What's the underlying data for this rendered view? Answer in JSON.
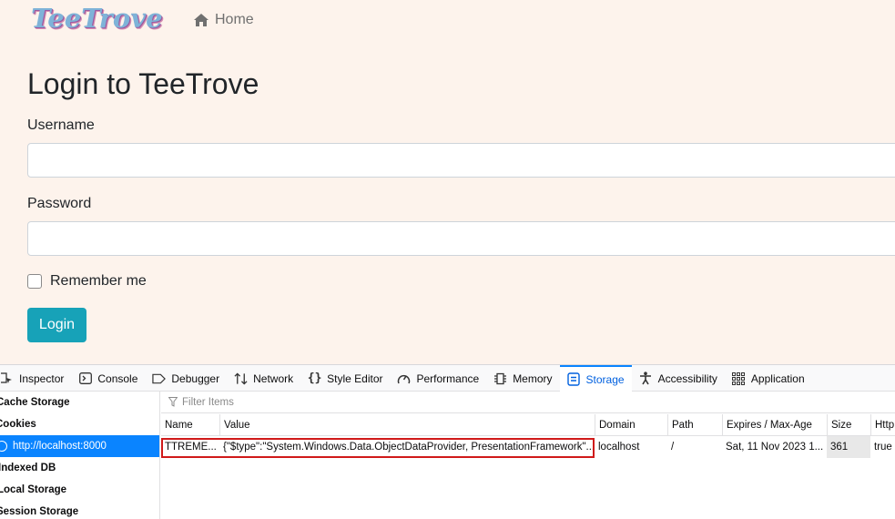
{
  "header": {
    "logo_text": "TeeTrove",
    "home_link": "Home",
    "home_icon": "home-icon"
  },
  "login_form": {
    "title": "Login to TeeTrove",
    "username_label": "Username",
    "username_value": "",
    "password_label": "Password",
    "password_value": "",
    "remember_label": "Remember me",
    "remember_checked": false,
    "submit_label": "Login"
  },
  "devtools": {
    "tabs": [
      {
        "label": "Inspector",
        "icon": "inspector-icon"
      },
      {
        "label": "Console",
        "icon": "console-icon"
      },
      {
        "label": "Debugger",
        "icon": "debugger-icon"
      },
      {
        "label": "Network",
        "icon": "network-icon"
      },
      {
        "label": "Style Editor",
        "icon": "style-editor-icon"
      },
      {
        "label": "Performance",
        "icon": "performance-icon"
      },
      {
        "label": "Memory",
        "icon": "memory-icon"
      },
      {
        "label": "Storage",
        "icon": "storage-icon"
      },
      {
        "label": "Accessibility",
        "icon": "accessibility-icon"
      },
      {
        "label": "Application",
        "icon": "application-icon"
      }
    ],
    "active_tab": "Storage",
    "sidebar": {
      "items": [
        {
          "label": "Cache Storage"
        },
        {
          "label": "Cookies"
        },
        {
          "label": "http://localhost:8000"
        },
        {
          "label": "Indexed DB"
        },
        {
          "label": "Local Storage"
        },
        {
          "label": "Session Storage"
        }
      ]
    },
    "filter_placeholder": "Filter Items",
    "table": {
      "columns": [
        "Name",
        "Value",
        "Domain",
        "Path",
        "Expires / Max-Age",
        "Size",
        "Http"
      ],
      "rows": [
        {
          "name": "TTREME...",
          "value": "{\"$type\":\"System.Windows.Data.ObjectDataProvider, PresentationFramework\"...",
          "domain": "localhost",
          "path": "/",
          "expires": "Sat, 11 Nov 2023 1...",
          "size": "361",
          "http": "true"
        }
      ]
    },
    "colors": {
      "accent": "#0a84ff",
      "highlight_border": "#d01a1a",
      "login_button": "#17a2b8",
      "page_background": "#fdf3ec"
    }
  }
}
